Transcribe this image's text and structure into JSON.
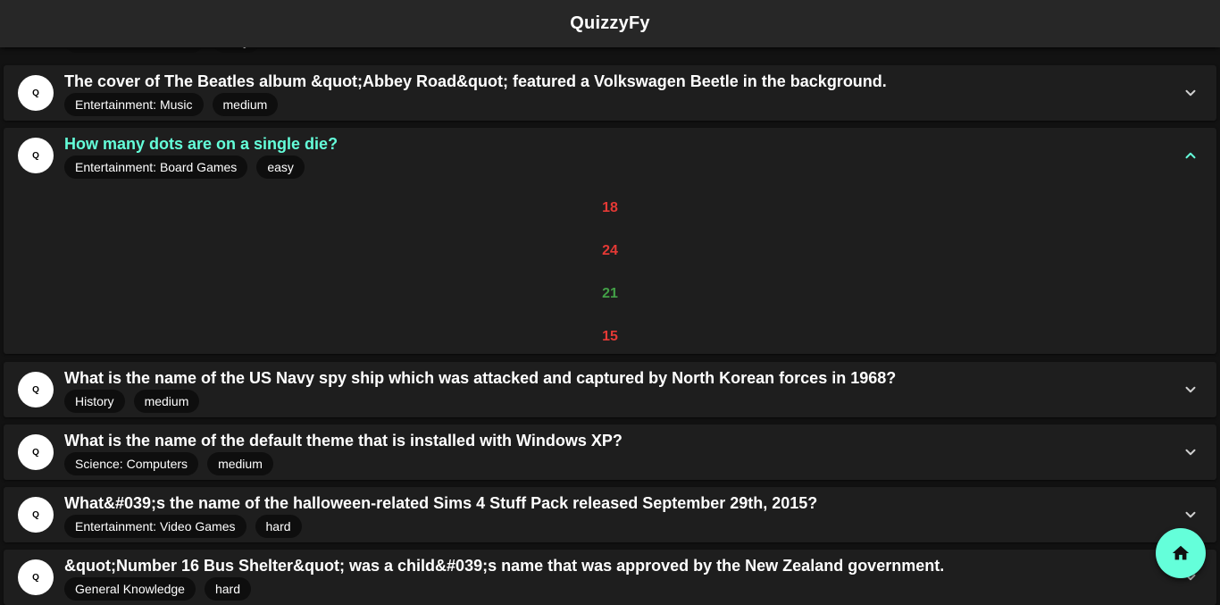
{
  "app": {
    "title": "QuizzyFy"
  },
  "colors": {
    "accent": "#64ffda",
    "wrong": "#e53935",
    "correct": "#43a047"
  },
  "avatar_letter": "Q",
  "partial_top_card": {
    "category": "Entertainment: Music",
    "difficulty": "easy"
  },
  "questions": [
    {
      "question": "The cover of The Beatles album &quot;Abbey Road&quot; featured a Volkswagen Beetle in the background.",
      "category": "Entertainment: Music",
      "difficulty": "medium",
      "expanded": false
    },
    {
      "question": "How many dots are on a single die?",
      "category": "Entertainment: Board Games",
      "difficulty": "easy",
      "expanded": true,
      "answers": [
        {
          "text": "18",
          "correct": false
        },
        {
          "text": "24",
          "correct": false
        },
        {
          "text": "21",
          "correct": true
        },
        {
          "text": "15",
          "correct": false
        }
      ]
    },
    {
      "question": "What is the name of the US Navy spy ship which was attacked and captured by North Korean forces in 1968?",
      "category": "History",
      "difficulty": "medium",
      "expanded": false
    },
    {
      "question": "What is the name of the default theme that is installed with Windows XP?",
      "category": "Science: Computers",
      "difficulty": "medium",
      "expanded": false
    },
    {
      "question": "What&#039;s the name of the halloween-related Sims 4 Stuff Pack released September 29th, 2015?",
      "category": "Entertainment: Video Games",
      "difficulty": "hard",
      "expanded": false
    },
    {
      "question": "&quot;Number 16 Bus Shelter&quot; was a child&#039;s name that was approved by the New Zealand government.",
      "category": "General Knowledge",
      "difficulty": "hard",
      "expanded": false
    }
  ],
  "fab": {
    "icon": "home-icon"
  }
}
